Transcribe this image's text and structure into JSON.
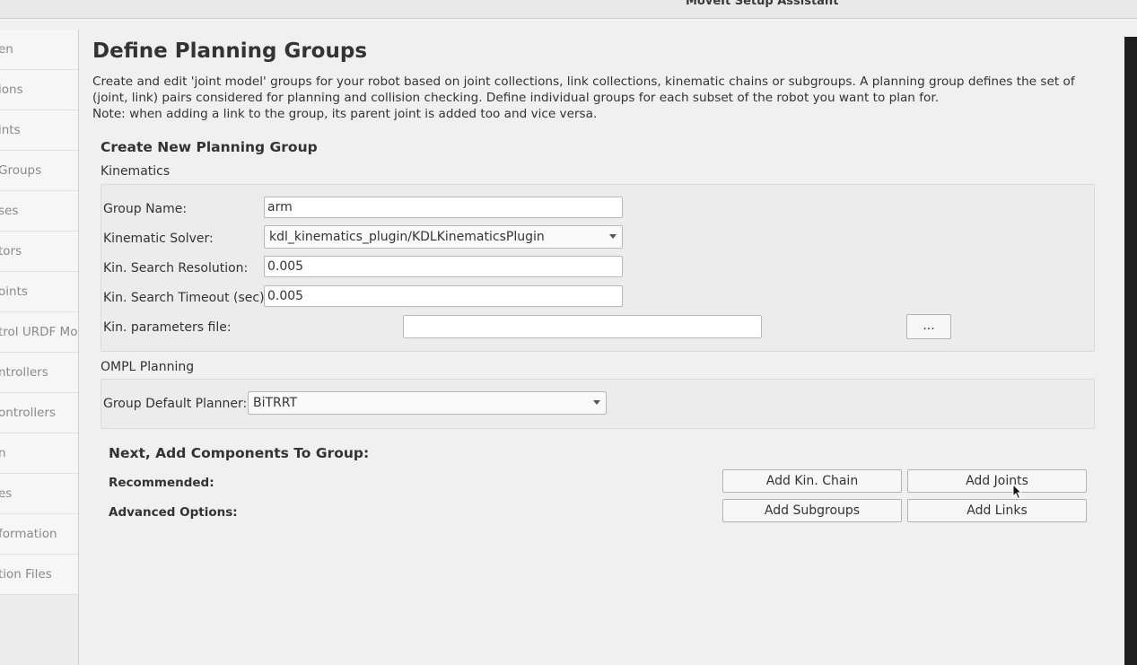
{
  "window": {
    "title": "MoveIt Setup Assistant"
  },
  "sidebar": {
    "items": [
      {
        "label": "en"
      },
      {
        "label": "ions"
      },
      {
        "label": "ints"
      },
      {
        "label": "Groups"
      },
      {
        "label": "ses"
      },
      {
        "label": "tors"
      },
      {
        "label": "oints"
      },
      {
        "label": "trol URDF Mod"
      },
      {
        "label": "ntrollers"
      },
      {
        "label": "ontrollers"
      },
      {
        "label": "n"
      },
      {
        "label": "es"
      },
      {
        "label": "formation"
      },
      {
        "label": "tion Files"
      }
    ]
  },
  "page": {
    "title": "Define Planning Groups",
    "description_1": "Create and edit 'joint model' groups for your robot based on joint collections, link collections, kinematic chains or subgroups. A planning group defines the set of (joint, link) pairs considered for planning and collision checking. Define individual groups for each subset of the robot you want to plan for.",
    "description_2": "Note: when adding a link to the group, its parent joint is added too and vice versa."
  },
  "form": {
    "section_title": "Create New Planning Group",
    "kinematics_label": "Kinematics",
    "group_name_label": "Group Name:",
    "group_name_value": "arm",
    "solver_label": "Kinematic Solver:",
    "solver_value": "kdl_kinematics_plugin/KDLKinematicsPlugin",
    "resolution_label": "Kin. Search Resolution:",
    "resolution_value": "0.005",
    "timeout_label": "Kin. Search Timeout (sec):",
    "timeout_value": "0.005",
    "params_label": "Kin. parameters file:",
    "params_value": "",
    "browse_label": "...",
    "ompl_label": "OMPL Planning",
    "planner_label": "Group Default Planner:",
    "planner_value": "BiTRRT"
  },
  "components": {
    "title": "Next, Add Components To Group:",
    "recommended_label": "Recommended:",
    "advanced_label": "Advanced Options:",
    "add_kin_chain": "Add Kin. Chain",
    "add_joints": "Add Joints",
    "add_subgroups": "Add Subgroups",
    "add_links": "Add Links"
  }
}
